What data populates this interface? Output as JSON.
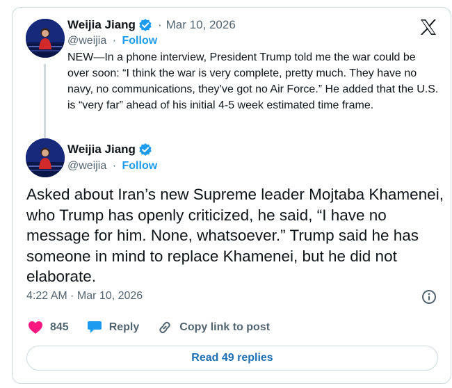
{
  "quoted_tweet": {
    "author_name": "Weijia Jiang",
    "date": "Mar 10, 2026",
    "handle": "@weijia",
    "follow_label": "Follow",
    "separator": "·",
    "text": "NEW—In a phone interview, President Trump told me the war could be over soon: “I think the war is very complete, pretty much. They have no navy, no communications, they’ve got no Air Force.” He added that the U.S. is “very far” ahead of his initial 4-5 week estimated time frame."
  },
  "main_tweet": {
    "author_name": "Weijia Jiang",
    "handle": "@weijia",
    "follow_label": "Follow",
    "separator": "·",
    "text": "Asked about Iran’s new Supreme leader Mojtaba Khamenei, who Trump has openly criticized, he said, “I have no message for him. None, whatsoever.” Trump said he has someone in mind to replace Khamenei, but he did not elaborate.",
    "timestamp": "4:22 AM · Mar 10, 2026"
  },
  "actions": {
    "like_count": "845",
    "reply_label": "Reply",
    "copy_link_label": "Copy link to post"
  },
  "read_replies_label": "Read 49 replies",
  "colors": {
    "accent": "#1d9bf0",
    "like": "#f91880",
    "text_secondary": "#536471",
    "border": "#cfd9de"
  },
  "icons": [
    "verified-badge-icon",
    "x-logo-icon",
    "info-icon",
    "heart-icon",
    "reply-bubble-icon",
    "link-icon"
  ]
}
